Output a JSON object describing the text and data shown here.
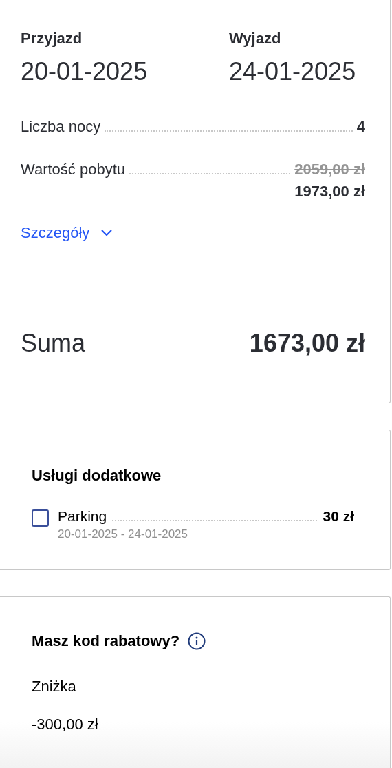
{
  "stay": {
    "arrival": {
      "label": "Przyjazd",
      "date": "20-01-2025"
    },
    "departure": {
      "label": "Wyjazd",
      "date": "24-01-2025"
    },
    "rows": [
      {
        "label": "Liczba nocy",
        "value": "4"
      },
      {
        "label": "Wartość pobytu",
        "old_value": "2059,00 zł",
        "value": "1973,00 zł"
      }
    ],
    "details": {
      "label": "Szczegóły",
      "expanded": false
    },
    "total": {
      "label": "Suma",
      "value": "1673,00 zł"
    }
  },
  "extras": {
    "title": "Usługi dodatkowe",
    "items": [
      {
        "label": "Parking",
        "dates": "20-01-2025 - 24-01-2025",
        "price": "30 zł",
        "checked": false
      }
    ]
  },
  "discount": {
    "title": "Masz kod rabatowy?",
    "label": "Zniżka",
    "value": "-300,00 zł"
  }
}
